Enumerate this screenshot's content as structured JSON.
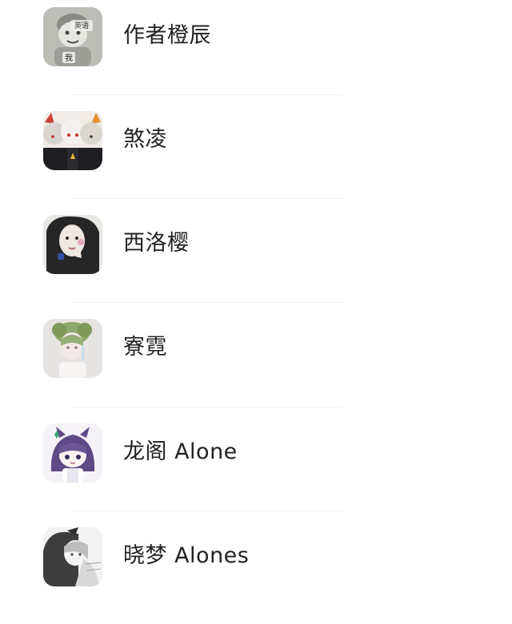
{
  "contacts": [
    {
      "name": "作者橙辰",
      "avatar_icon": "avatar-manga-character",
      "avatar_text_top": "英语",
      "avatar_text_bottom": "我"
    },
    {
      "name": "煞凌",
      "avatar_icon": "avatar-anime-trio"
    },
    {
      "name": "西洛樱",
      "avatar_icon": "avatar-girl-photo"
    },
    {
      "name": "寮霓",
      "avatar_icon": "avatar-green-hair-girl"
    },
    {
      "name": "龙阁 Alone",
      "avatar_icon": "avatar-purple-chibi"
    },
    {
      "name": "晓梦 Alones",
      "avatar_icon": "avatar-sketch-girl"
    }
  ]
}
